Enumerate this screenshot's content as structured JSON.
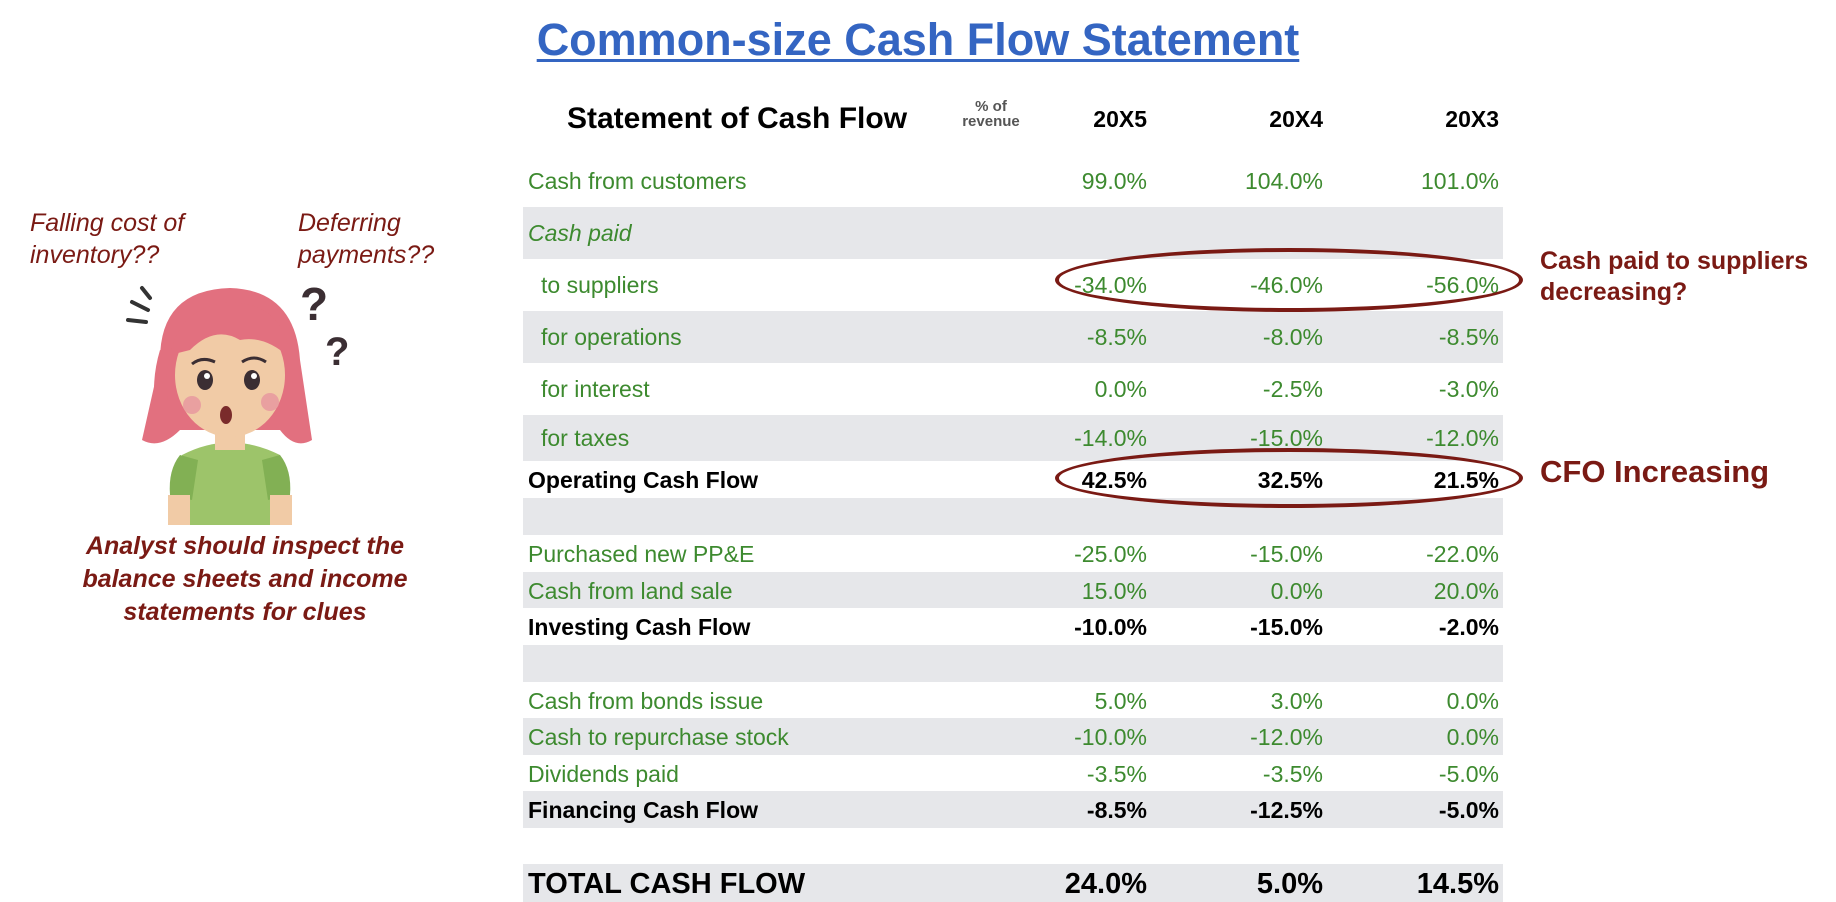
{
  "title": "Common-size Cash Flow Statement",
  "header": {
    "statement_title": "Statement of Cash Flow",
    "unit_line1": "% of",
    "unit_line2": "revenue",
    "years": [
      "20X5",
      "20X4",
      "20X3"
    ]
  },
  "rows": [
    {
      "label": "Cash from customers",
      "values": [
        "99.0%",
        "104.0%",
        "101.0%"
      ]
    },
    {
      "label": "Cash paid",
      "values": [
        "",
        "",
        ""
      ]
    },
    {
      "label": "to suppliers",
      "values": [
        "-34.0%",
        "-46.0%",
        "-56.0%"
      ]
    },
    {
      "label": "for operations",
      "values": [
        "-8.5%",
        "-8.0%",
        "-8.5%"
      ]
    },
    {
      "label": "for interest",
      "values": [
        "0.0%",
        "-2.5%",
        "-3.0%"
      ]
    },
    {
      "label": "for taxes",
      "values": [
        "-14.0%",
        "-15.0%",
        "-12.0%"
      ]
    },
    {
      "label": "Operating Cash Flow",
      "values": [
        "42.5%",
        "32.5%",
        "21.5%"
      ]
    },
    {
      "label": "",
      "values": [
        "",
        "",
        ""
      ]
    },
    {
      "label": "Purchased new PP&E",
      "values": [
        "-25.0%",
        "-15.0%",
        "-22.0%"
      ]
    },
    {
      "label": "Cash from land sale",
      "values": [
        "15.0%",
        "0.0%",
        "20.0%"
      ]
    },
    {
      "label": "Investing Cash Flow",
      "values": [
        "-10.0%",
        "-15.0%",
        "-2.0%"
      ]
    },
    {
      "label": "",
      "values": [
        "",
        "",
        ""
      ]
    },
    {
      "label": "Cash from bonds issue",
      "values": [
        "5.0%",
        "3.0%",
        "0.0%"
      ]
    },
    {
      "label": "Cash to repurchase stock",
      "values": [
        "-10.0%",
        "-12.0%",
        "0.0%"
      ]
    },
    {
      "label": "Dividends paid",
      "values": [
        "-3.5%",
        "-3.5%",
        "-5.0%"
      ]
    },
    {
      "label": "Financing Cash Flow",
      "values": [
        "-8.5%",
        "-12.5%",
        "-5.0%"
      ]
    },
    {
      "label": "",
      "values": [
        "",
        "",
        ""
      ]
    },
    {
      "label": "TOTAL CASH FLOW",
      "values": [
        "24.0%",
        "5.0%",
        "14.5%"
      ]
    }
  ],
  "annotations": {
    "suppliers_line1": "Cash paid to suppliers",
    "suppliers_line2": "decreasing?",
    "cfo": "CFO Increasing"
  },
  "notes": {
    "inventory_line1": "Falling cost of",
    "inventory_line2": "inventory??",
    "deferring_line1": "Deferring",
    "deferring_line2": "payments??",
    "analyst_line1": "Analyst should inspect the",
    "analyst_line2": "balance sheets and income",
    "analyst_line3": "statements for clues"
  },
  "colors": {
    "title": "#3465c2",
    "line_items": "#3d8a2f",
    "annotation": "#7a1a14",
    "shade": "#e6e7ea"
  }
}
